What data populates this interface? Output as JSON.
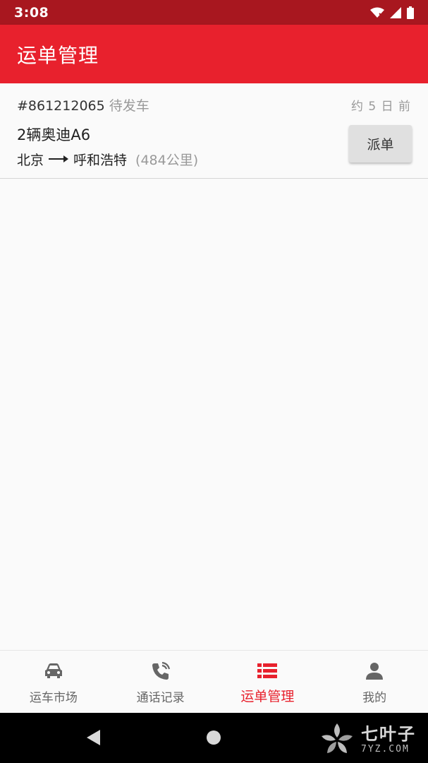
{
  "status_bar": {
    "time": "3:08",
    "icons": [
      "wifi-icon",
      "cell-signal-icon",
      "battery-icon"
    ]
  },
  "app_bar": {
    "title": "运单管理"
  },
  "orders": [
    {
      "number": "#861212065",
      "status": "待发车",
      "time_ago": "约 5 日 前",
      "vehicle": "2辆奥迪A6",
      "origin": "北京",
      "destination": "呼和浩特",
      "distance": "(484公里)",
      "action_label": "派单"
    }
  ],
  "bottom_nav": {
    "active_index": 2,
    "items": [
      {
        "label": "运车市场",
        "icon": "car-icon"
      },
      {
        "label": "通话记录",
        "icon": "phone-log-icon"
      },
      {
        "label": "运单管理",
        "icon": "list-icon"
      },
      {
        "label": "我的",
        "icon": "person-icon"
      }
    ]
  },
  "watermark": {
    "main": "七叶子",
    "sub": "7YZ.COM"
  },
  "colors": {
    "primary": "#e8212d",
    "status_bar": "#a8171f",
    "inactive": "#666666",
    "secondary_text": "#999999"
  }
}
